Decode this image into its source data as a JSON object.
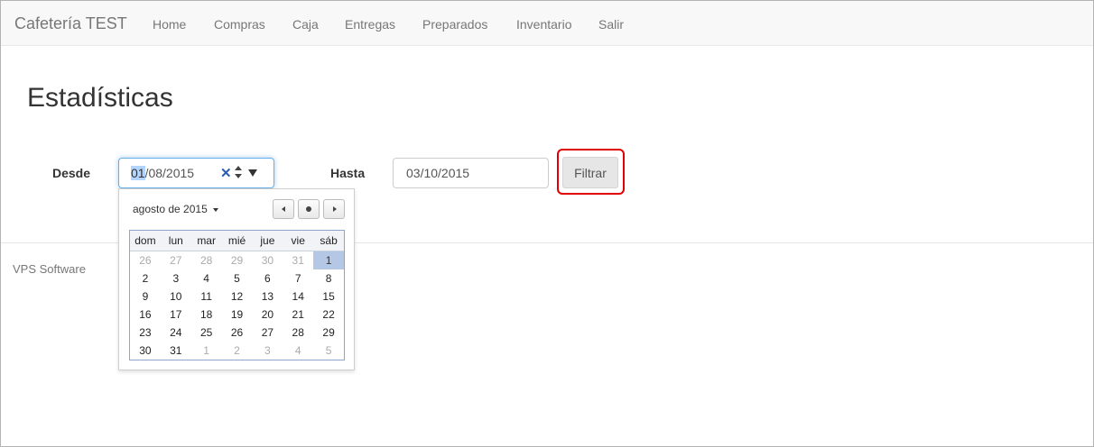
{
  "navbar": {
    "brand": "Cafetería TEST",
    "items": [
      {
        "label": "Home"
      },
      {
        "label": "Compras"
      },
      {
        "label": "Caja"
      },
      {
        "label": "Entregas"
      },
      {
        "label": "Preparados"
      },
      {
        "label": "Inventario"
      },
      {
        "label": "Salir"
      }
    ]
  },
  "page": {
    "title": "Estadísticas"
  },
  "filters": {
    "from_label": "Desde",
    "from_value_selected": "01",
    "from_value_rest": "/08/2015",
    "to_label": "Hasta",
    "to_value": "03/10/2015",
    "filter_button": "Filtrar"
  },
  "calendar": {
    "month_label": "agosto de 2015",
    "weekdays": [
      "dom",
      "lun",
      "mar",
      "mié",
      "jue",
      "vie",
      "sáb"
    ],
    "weeks": [
      [
        "26",
        "27",
        "28",
        "29",
        "30",
        "31",
        "1"
      ],
      [
        "2",
        "3",
        "4",
        "5",
        "6",
        "7",
        "8"
      ],
      [
        "9",
        "10",
        "11",
        "12",
        "13",
        "14",
        "15"
      ],
      [
        "16",
        "17",
        "18",
        "19",
        "20",
        "21",
        "22"
      ],
      [
        "23",
        "24",
        "25",
        "26",
        "27",
        "28",
        "29"
      ],
      [
        "30",
        "31",
        "1",
        "2",
        "3",
        "4",
        "5"
      ]
    ]
  },
  "footer": {
    "text": "VPS Software"
  },
  "colors": {
    "highlight_border": "#e00000",
    "selected_day": "#b4c8e6",
    "focus_border": "#66afe9"
  }
}
